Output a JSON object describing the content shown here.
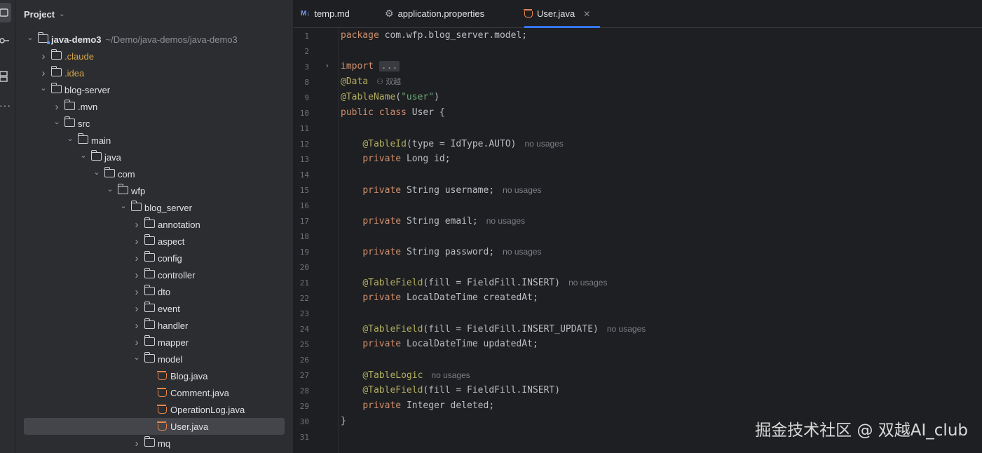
{
  "project_panel": {
    "title": "Project",
    "tree": [
      {
        "label": "java-demo3",
        "path": "~/Demo/java-demos/java-demo3",
        "depth": 0,
        "expanded": true,
        "kind": "module",
        "bold": true
      },
      {
        "label": ".claude",
        "depth": 1,
        "expanded": false,
        "kind": "folder",
        "orange": true
      },
      {
        "label": ".idea",
        "depth": 1,
        "expanded": false,
        "kind": "folder",
        "orange": true
      },
      {
        "label": "blog-server",
        "depth": 1,
        "expanded": true,
        "kind": "folder"
      },
      {
        "label": ".mvn",
        "depth": 2,
        "expanded": false,
        "kind": "folder"
      },
      {
        "label": "src",
        "depth": 2,
        "expanded": true,
        "kind": "folder"
      },
      {
        "label": "main",
        "depth": 3,
        "expanded": true,
        "kind": "folder"
      },
      {
        "label": "java",
        "depth": 4,
        "expanded": true,
        "kind": "folder"
      },
      {
        "label": "com",
        "depth": 5,
        "expanded": true,
        "kind": "folder"
      },
      {
        "label": "wfp",
        "depth": 6,
        "expanded": true,
        "kind": "folder"
      },
      {
        "label": "blog_server",
        "depth": 7,
        "expanded": true,
        "kind": "folder"
      },
      {
        "label": "annotation",
        "depth": 8,
        "expanded": false,
        "kind": "folder"
      },
      {
        "label": "aspect",
        "depth": 8,
        "expanded": false,
        "kind": "folder"
      },
      {
        "label": "config",
        "depth": 8,
        "expanded": false,
        "kind": "folder"
      },
      {
        "label": "controller",
        "depth": 8,
        "expanded": false,
        "kind": "folder"
      },
      {
        "label": "dto",
        "depth": 8,
        "expanded": false,
        "kind": "folder"
      },
      {
        "label": "event",
        "depth": 8,
        "expanded": false,
        "kind": "folder"
      },
      {
        "label": "handler",
        "depth": 8,
        "expanded": false,
        "kind": "folder"
      },
      {
        "label": "mapper",
        "depth": 8,
        "expanded": false,
        "kind": "folder"
      },
      {
        "label": "model",
        "depth": 8,
        "expanded": true,
        "kind": "folder"
      },
      {
        "label": "Blog.java",
        "depth": 9,
        "kind": "java"
      },
      {
        "label": "Comment.java",
        "depth": 9,
        "kind": "java"
      },
      {
        "label": "OperationLog.java",
        "depth": 9,
        "kind": "java"
      },
      {
        "label": "User.java",
        "depth": 9,
        "kind": "java",
        "selected": true
      },
      {
        "label": "mq",
        "depth": 8,
        "expanded": false,
        "kind": "folder"
      }
    ]
  },
  "tabs": [
    {
      "label": "temp.md",
      "icon": "markdown-icon",
      "icon_text": "M↓"
    },
    {
      "label": "application.properties",
      "icon": "gear-icon"
    },
    {
      "label": "User.java",
      "icon": "java-class-icon",
      "active": true,
      "closable": true
    }
  ],
  "editor": {
    "lines": [
      {
        "n": "1",
        "tokens": [
          [
            "kw",
            "package "
          ],
          [
            "plain",
            "com.wfp.blog_server.model;"
          ]
        ]
      },
      {
        "n": "2",
        "tokens": []
      },
      {
        "n": "3",
        "fold": true,
        "tokens": [
          [
            "kw",
            "import "
          ],
          [
            "fold",
            "..."
          ]
        ]
      },
      {
        "n": "8",
        "tokens": [
          [
            "ann",
            "@Data"
          ]
        ],
        "author": "双越"
      },
      {
        "n": "9",
        "tokens": [
          [
            "ann",
            "@TableName"
          ],
          [
            "plain",
            "("
          ],
          [
            "str",
            "\"user\""
          ],
          [
            "plain",
            ")"
          ]
        ]
      },
      {
        "n": "10",
        "tokens": [
          [
            "kw",
            "public class "
          ],
          [
            "plain",
            "User {"
          ]
        ]
      },
      {
        "n": "11",
        "tokens": []
      },
      {
        "n": "12",
        "tokens": [
          [
            "plain",
            "    "
          ],
          [
            "ann",
            "@TableId"
          ],
          [
            "plain",
            "(type = IdType.AUTO)"
          ]
        ],
        "hint": "no usages"
      },
      {
        "n": "13",
        "tokens": [
          [
            "plain",
            "    "
          ],
          [
            "kw",
            "private "
          ],
          [
            "plain",
            "Long id;"
          ]
        ]
      },
      {
        "n": "14",
        "tokens": []
      },
      {
        "n": "15",
        "tokens": [
          [
            "plain",
            "    "
          ],
          [
            "kw",
            "private "
          ],
          [
            "plain",
            "String username;"
          ]
        ],
        "hint": "no usages"
      },
      {
        "n": "16",
        "tokens": []
      },
      {
        "n": "17",
        "tokens": [
          [
            "plain",
            "    "
          ],
          [
            "kw",
            "private "
          ],
          [
            "plain",
            "String email;"
          ]
        ],
        "hint": "no usages"
      },
      {
        "n": "18",
        "tokens": []
      },
      {
        "n": "19",
        "tokens": [
          [
            "plain",
            "    "
          ],
          [
            "kw",
            "private "
          ],
          [
            "plain",
            "String password;"
          ]
        ],
        "hint": "no usages"
      },
      {
        "n": "20",
        "tokens": []
      },
      {
        "n": "21",
        "tokens": [
          [
            "plain",
            "    "
          ],
          [
            "ann",
            "@TableField"
          ],
          [
            "plain",
            "(fill = FieldFill.INSERT)"
          ]
        ],
        "hint": "no usages"
      },
      {
        "n": "22",
        "tokens": [
          [
            "plain",
            "    "
          ],
          [
            "kw",
            "private "
          ],
          [
            "plain",
            "LocalDateTime createdAt;"
          ]
        ]
      },
      {
        "n": "23",
        "tokens": []
      },
      {
        "n": "24",
        "tokens": [
          [
            "plain",
            "    "
          ],
          [
            "ann",
            "@TableField"
          ],
          [
            "plain",
            "(fill = FieldFill.INSERT_UPDATE)"
          ]
        ],
        "hint": "no usages"
      },
      {
        "n": "25",
        "tokens": [
          [
            "plain",
            "    "
          ],
          [
            "kw",
            "private "
          ],
          [
            "plain",
            "LocalDateTime updatedAt;"
          ]
        ]
      },
      {
        "n": "26",
        "tokens": []
      },
      {
        "n": "27",
        "tokens": [
          [
            "plain",
            "    "
          ],
          [
            "ann",
            "@TableLogic"
          ]
        ],
        "hint": "no usages"
      },
      {
        "n": "28",
        "tokens": [
          [
            "plain",
            "    "
          ],
          [
            "ann",
            "@TableField"
          ],
          [
            "plain",
            "(fill = FieldFill.INSERT)"
          ]
        ]
      },
      {
        "n": "29",
        "tokens": [
          [
            "plain",
            "    "
          ],
          [
            "kw",
            "private "
          ],
          [
            "plain",
            "Integer deleted;"
          ]
        ]
      },
      {
        "n": "30",
        "tokens": [
          [
            "plain",
            "}"
          ]
        ]
      },
      {
        "n": "31",
        "tokens": []
      }
    ]
  },
  "watermark": "掘金技术社区 @ 双越AI_club",
  "colors": {
    "background": "#1e1f22",
    "panel": "#2b2d30",
    "accent": "#3574f0",
    "keyword": "#cf8e6d",
    "annotation": "#b3ae60",
    "string": "#6aab73",
    "java_icon": "#e8844a"
  }
}
